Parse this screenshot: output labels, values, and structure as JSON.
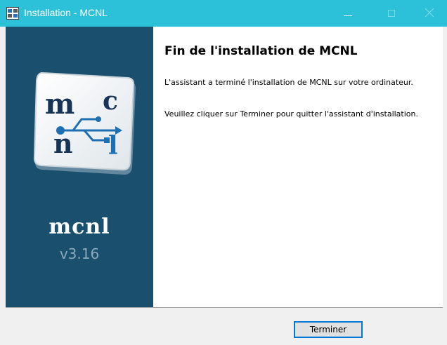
{
  "window": {
    "title": "Installation - MCNL",
    "icon": "installer-app-icon",
    "titlebar_color": "#2cc1d9"
  },
  "titlebar_buttons": {
    "minimize_icon": "minimize-icon",
    "maximize_icon": "maximize-icon",
    "close_icon": "close-icon"
  },
  "sidebar": {
    "background": "#1a4f6e",
    "logo_letters": [
      "m",
      "c",
      "n",
      "l"
    ],
    "logo_icon": "usb-icon",
    "brand": "mcnl",
    "version": "v3.16"
  },
  "main": {
    "title": "Fin de l'installation de MCNL",
    "paragraph1": "L'assistant a terminé l'installation de MCNL sur votre ordinateur.",
    "paragraph2": "Veuillez cliquer sur Terminer pour quitter l'assistant d'installation."
  },
  "footer": {
    "finish_label": "Terminer",
    "accent": "#0078d7"
  }
}
